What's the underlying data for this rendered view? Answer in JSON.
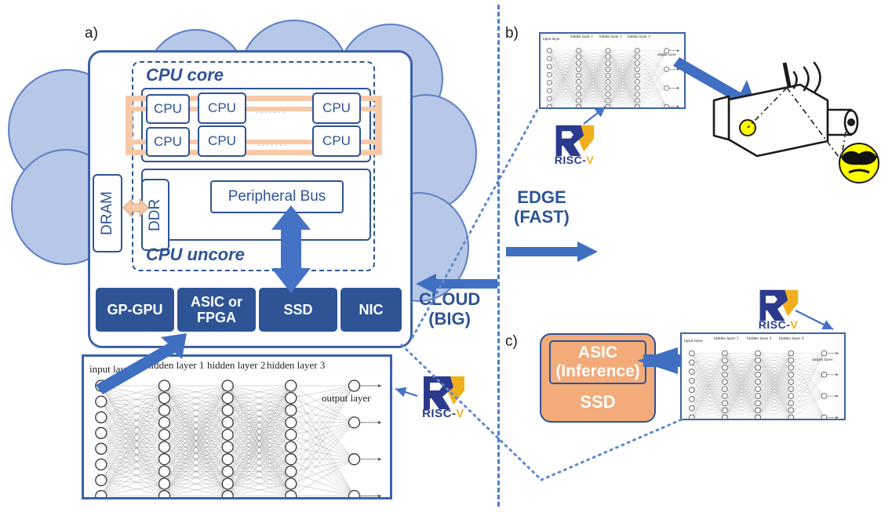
{
  "figure": {
    "panels": [
      {
        "key": "a",
        "label": "a)"
      },
      {
        "key": "b",
        "label": "b)"
      },
      {
        "key": "c",
        "label": "c)"
      }
    ]
  },
  "panel_a": {
    "label": "a)",
    "cpu_core": {
      "title": "CPU core",
      "row1": [
        "CPU",
        "CPU",
        "CPU"
      ],
      "row2": [
        "CPU",
        "CPU",
        "CPU"
      ],
      "ellipsis": "......."
    },
    "uncore": {
      "title": "CPU uncore",
      "peripheral_bus": "Peripheral Bus",
      "ddr": "DDR"
    },
    "dram": "DRAM",
    "accelerators": [
      {
        "label": "GP-GPU"
      },
      {
        "label": "ASIC or\nFPGA"
      },
      {
        "label": "SSD"
      },
      {
        "label": "NIC"
      }
    ],
    "neural_net": {
      "input_layer": "input layer",
      "hidden_layers": [
        "hidden layer 1",
        "hidden layer 2",
        "hidden layer 3"
      ],
      "output_layer": "output layer",
      "node_counts": [
        8,
        10,
        10,
        10,
        4
      ]
    },
    "riscv_logo": {
      "text_dark": "RISC-",
      "text_gold": "V"
    }
  },
  "panel_b": {
    "label": "b)",
    "neural_net": {
      "input_layer": "input layer",
      "hidden_layers": [
        "hidden layer 1",
        "hidden layer 2",
        "hidden layer 3"
      ],
      "output_layer": "output layer",
      "node_counts": [
        8,
        10,
        10,
        10,
        4
      ]
    },
    "riscv_logo": {
      "text_dark": "RISC-",
      "text_gold": "V"
    },
    "camera": {
      "alt": "wireless surveillance camera",
      "target": "masked intruder face"
    }
  },
  "panel_c": {
    "label": "c)",
    "ssd_block": {
      "asic_line1": "ASIC",
      "asic_line2": "(Inference)",
      "ssd_label": "SSD"
    },
    "neural_net": {
      "input_layer": "input layer",
      "hidden_layers": [
        "hidden layer 1",
        "hidden layer 2",
        "hidden layer 3"
      ],
      "output_layer": "output layer",
      "node_counts": [
        8,
        10,
        10,
        10,
        4
      ]
    },
    "riscv_logo": {
      "text_dark": "RISC-",
      "text_gold": "V"
    }
  },
  "center": {
    "edge": {
      "line1": "EDGE",
      "line2": "(FAST)"
    },
    "cloud": {
      "line1": "CLOUD",
      "line2": "(BIG)"
    }
  },
  "colors": {
    "navy": "#2e5496",
    "arrow_blue": "#4472c4",
    "cloud_fill": "#b7c7e8",
    "cloud_stroke": "#5b7fc4",
    "orange": "#f2ab79",
    "bus_peach": "#f7c9a8",
    "riscv_gold": "#f2b01e",
    "riscv_navy": "#2b3a8c",
    "camera_eye": "#ffff00"
  }
}
